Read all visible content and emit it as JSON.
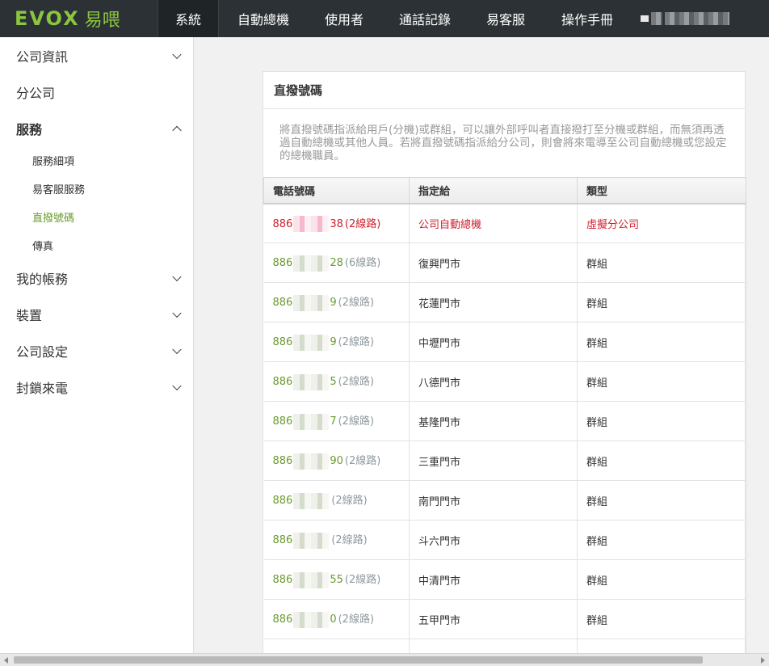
{
  "brand": {
    "logo_en": "EVOX",
    "logo_zh": "易喂",
    "accent": "#8cc63f"
  },
  "topnav": {
    "items": [
      {
        "label": "系統",
        "active": true
      },
      {
        "label": "自動總機"
      },
      {
        "label": "使用者"
      },
      {
        "label": "通話記錄"
      },
      {
        "label": "易客服"
      },
      {
        "label": "操作手冊"
      }
    ]
  },
  "sidebar": {
    "company_info": "公司資訊",
    "branch": "分公司",
    "services": "服務",
    "sub": {
      "service_detail": "服務細項",
      "ekefu_service": "易客服服務",
      "direct_number": "直撥號碼",
      "fax": "傳真"
    },
    "my_account": "我的帳務",
    "devices": "裝置",
    "company_settings": "公司設定",
    "block_calls": "封鎖來電"
  },
  "card": {
    "title": "直撥號碼",
    "description": "將直撥號碼指派給用戶(分機)或群組，可以讓外部呼叫者直接撥打至分機或群組，而無須再透過自動總機或其他人員。若將直撥號碼指派給分公司，則會將來電導至公司自動總機或您設定的總機職員。"
  },
  "table": {
    "headers": {
      "phone": "電話號碼",
      "assigned": "指定給",
      "type": "類型"
    },
    "rows": [
      {
        "prefix": "886",
        "suffix": "38",
        "lines": "(2線路)",
        "assigned": "公司自動總機",
        "type": "虛擬分公司"
      },
      {
        "prefix": "886",
        "suffix": "28",
        "lines": "(6線路)",
        "assigned": "復興門市",
        "type": "群組"
      },
      {
        "prefix": "886",
        "suffix": "9",
        "lines": "(2線路)",
        "assigned": "花蓮門市",
        "type": "群組"
      },
      {
        "prefix": "886",
        "suffix": "9",
        "lines": "(2線路)",
        "assigned": "中壢門市",
        "type": "群組"
      },
      {
        "prefix": "886",
        "suffix": "5",
        "lines": "(2線路)",
        "assigned": "八德門市",
        "type": "群組"
      },
      {
        "prefix": "886",
        "suffix": "7",
        "lines": "(2線路)",
        "assigned": "基隆門市",
        "type": "群組"
      },
      {
        "prefix": "886",
        "suffix": "90",
        "lines": "(2線路)",
        "assigned": "三重門市",
        "type": "群組"
      },
      {
        "prefix": "886",
        "suffix": "",
        "lines": "(2線路)",
        "assigned": "南門門市",
        "type": "群組"
      },
      {
        "prefix": "886",
        "suffix": "",
        "lines": "(2線路)",
        "assigned": "斗六門市",
        "type": "群組"
      },
      {
        "prefix": "886",
        "suffix": "55",
        "lines": "(2線路)",
        "assigned": "中清門市",
        "type": "群組"
      },
      {
        "prefix": "886",
        "suffix": "0",
        "lines": "(2線路)",
        "assigned": "五甲門市",
        "type": "群組"
      }
    ]
  },
  "colors": {
    "topbar": "#2b3134",
    "link_green": "#6b9a2e",
    "highlight_red": "#d0202e"
  }
}
